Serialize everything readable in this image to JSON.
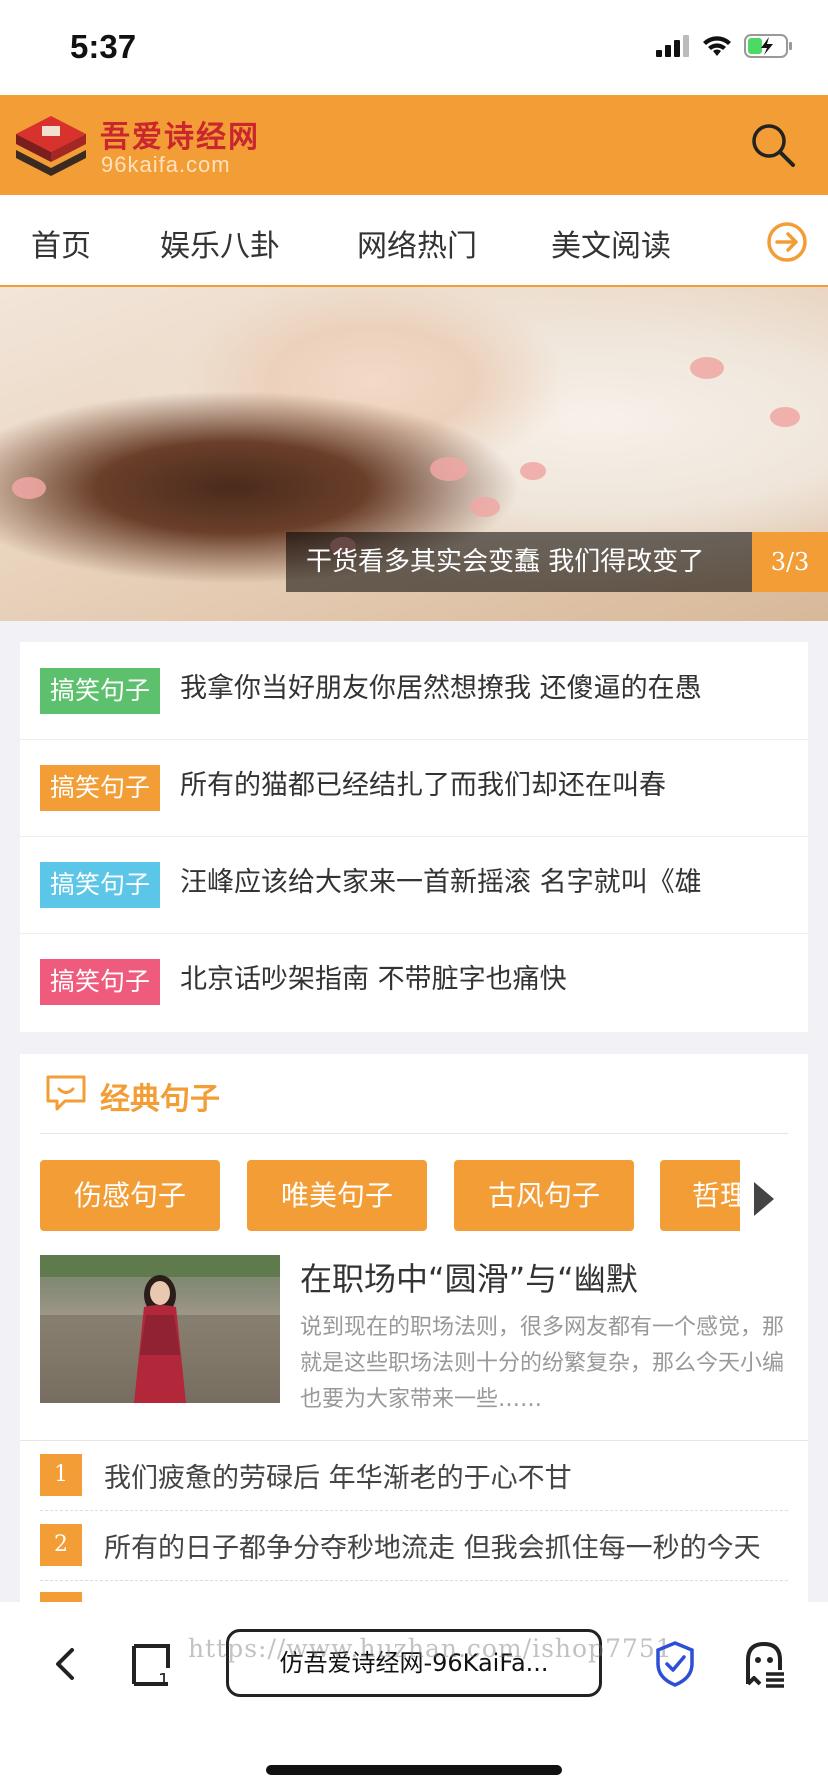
{
  "status_bar": {
    "time": "5:37"
  },
  "header": {
    "site_name": "吾爱诗经网",
    "domain": "96kaifa.com",
    "search_icon": "search-icon",
    "brand_color": "#f29d36"
  },
  "nav": {
    "items": [
      "首页",
      "娱乐八卦",
      "网络热门",
      "美文阅读"
    ],
    "more_icon": "arrow-right-circle-icon"
  },
  "banner": {
    "caption": "干货看多其实会变蠢 我们得改变了",
    "counter": "3/3"
  },
  "news": [
    {
      "tag": "搞笑句子",
      "tag_color": "#5cc06c",
      "title": "我拿你当好朋友你居然想撩我 还傻逼的在愚"
    },
    {
      "tag": "搞笑句子",
      "tag_color": "#f29d36",
      "title": "所有的猫都已经结扎了而我们却还在叫春"
    },
    {
      "tag": "搞笑句子",
      "tag_color": "#5bc6e8",
      "title": "汪峰应该给大家来一首新摇滚 名字就叫《雄"
    },
    {
      "tag": "搞笑句子",
      "tag_color": "#ee5b7d",
      "title": "北京话吵架指南 不带脏字也痛快"
    }
  ],
  "classic": {
    "title": "经典句子",
    "icon": "chat-bubble-icon",
    "categories": [
      "伤感句子",
      "唯美句子",
      "古风句子",
      "哲理"
    ],
    "feature": {
      "title": "在职场中“圆滑”与“幽默",
      "description": "说到现在的职场法则，很多网友都有一个感觉，那就是这些职场法则十分的纷繁复杂，那么今天小编也要为大家带来一些……"
    },
    "ranked": [
      {
        "num": "1",
        "title": "我们疲惫的劳碌后 年华渐老的于心不甘"
      },
      {
        "num": "2",
        "title": "所有的日子都争分夺秒地流走 但我会抓住每一秒的今天"
      }
    ]
  },
  "toolbar": {
    "url_label": "仿吾爱诗经网-96KaiFa...",
    "watermark": "https://www.huzhan.com/ishop7751"
  }
}
